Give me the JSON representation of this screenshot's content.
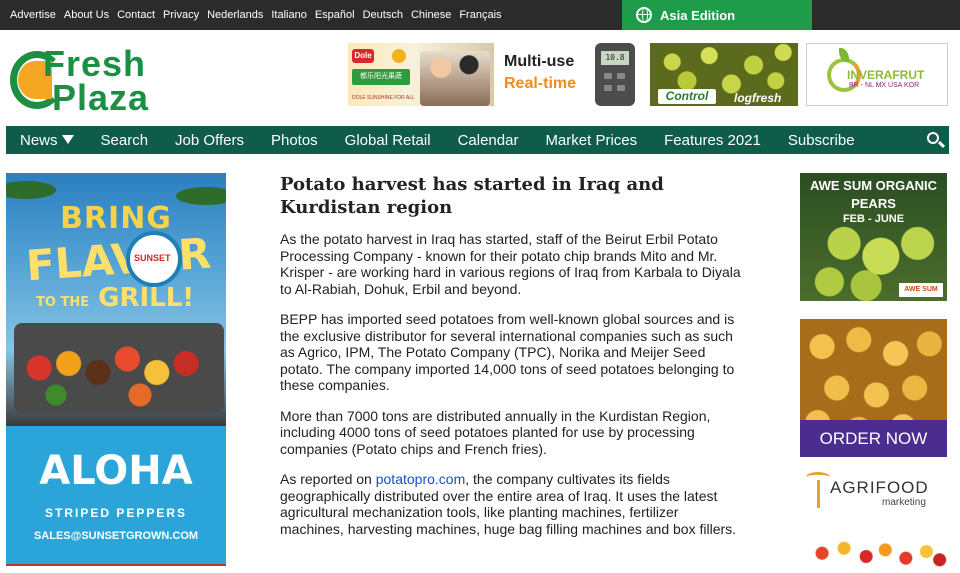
{
  "topbar": {
    "links": [
      "Advertise",
      "About Us",
      "Contact",
      "Privacy",
      "Nederlands",
      "Italiano",
      "Español",
      "Deutsch",
      "Chinese",
      "Français"
    ],
    "edition": "Asia Edition"
  },
  "logo": {
    "line1": "Fresh",
    "line2": "Plaza"
  },
  "ads": {
    "dole": {
      "brand": "Dole",
      "chinese": "都乐阳光果蔬",
      "sub": "DOLE SUNSHINE FOR ALL"
    },
    "multiuse": {
      "line1": "Multi-use",
      "line2": "Real-time",
      "device_readout": "10.8"
    },
    "control": {
      "word1": "Control",
      "word2": "logfresh"
    },
    "inverafrut": {
      "name": "INVERAFRUT",
      "sub": "BR - NL MX USA KOR"
    }
  },
  "nav": {
    "items": [
      "News",
      "Search",
      "Job Offers",
      "Photos",
      "Global Retail",
      "Calendar",
      "Market Prices",
      "Features 2021",
      "Subscribe"
    ]
  },
  "leftad": {
    "bring": "BRING",
    "flavor": "FLAVOR",
    "to_the": "TO THE",
    "grill": "GRILL!",
    "sunset": "SUNSET",
    "aloha": "ALOHA",
    "striped": "STRIPED PEPPERS",
    "sales": "SALES@SUNSETGROWN.COM"
  },
  "article": {
    "title": "Potato harvest has started in Iraq and Kurdistan region",
    "p1": "As the potato harvest in Iraq has started, staff of the Beirut Erbil Potato Processing Company - known for their potato chip brands Mito and Mr. Krisper - are working hard in various regions of Iraq from Karbala to Diyala to Al-Rabiah, Dohuk, Erbil and beyond.",
    "p2": "BEPP has imported seed potatoes from well-known global sources and is the exclusive distributor for several international companies such as such as Agrico, IPM, The Potato Company (TPC), Norika and Meijer Seed potato. The company imported 14,000 tons of seed potatoes belonging to these companies.",
    "p3": "More than 7000 tons are distributed annually in the Kurdistan Region, including 4000 tons of seed potatoes planted for use by processing companies (Potato chips and French fries).",
    "p4_prefix": "As reported on ",
    "p4_link": "potatopro.com",
    "p4_suffix": ", the company cultivates its fields geographically distributed over the entire area of Iraq. It uses the latest agricultural mechanization tools, like planting machines, fertilizer machines, harvesting machines, huge bag filling machines and box fillers."
  },
  "rightads": {
    "pears_line1": "AWE SUM ORGANIC",
    "pears_line2": "PEARS",
    "pears_line3": "FEB - JUNE",
    "pears_brand": "AWE SUM",
    "order_now": "ORDER NOW",
    "agrifood1": "AGRIFOOD",
    "agrifood2": "marketing"
  },
  "colors": {
    "topbar": "#2b2b2b",
    "edition_green": "#1e9c4a",
    "nav_green": "#0f5c4a",
    "logo_green": "#1d8f45",
    "link_blue": "#1a4fc4",
    "order_purple": "#4a2d8f"
  },
  "icons": [
    "globe-icon",
    "dropdown-arrow-icon",
    "search-icon"
  ]
}
